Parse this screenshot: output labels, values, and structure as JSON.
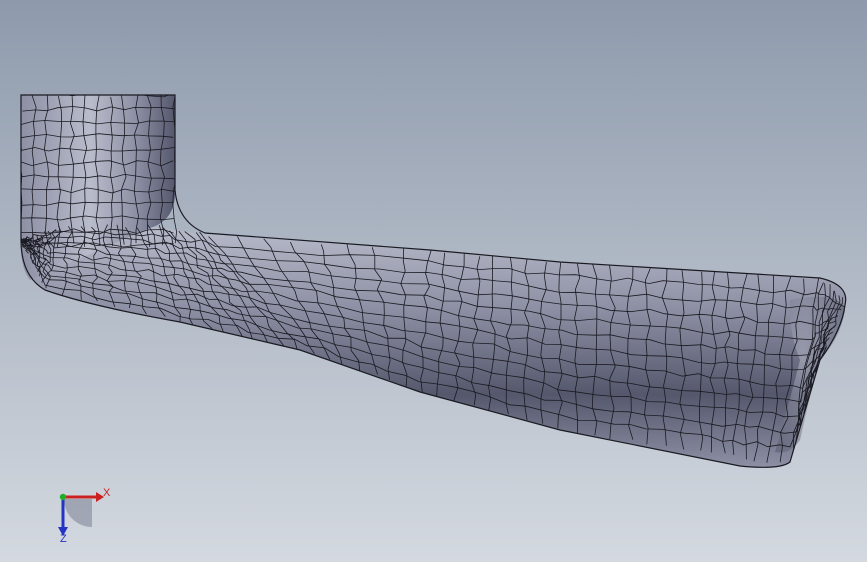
{
  "viewport": {
    "background_top": "#8e9aac",
    "background_bottom": "#d4d9e0"
  },
  "model": {
    "fill_light": "#b9bccb",
    "fill_mid": "#8d90a4",
    "fill_dark": "#55586c",
    "edge_color": "#1a1a22"
  },
  "triad": {
    "x_label": "X",
    "z_label": "Z",
    "x_color": "#cc1f1f",
    "y_color": "#1fae2a",
    "z_color": "#2433c4"
  }
}
